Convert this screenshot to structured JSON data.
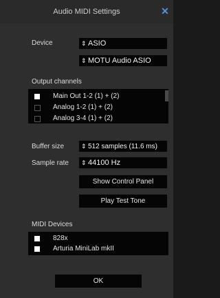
{
  "window": {
    "title": "Audio MIDI Settings"
  },
  "device": {
    "label": "Device",
    "driver": "ASIO",
    "interface": "MOTU Audio ASIO"
  },
  "output": {
    "heading": "Output channels",
    "items": [
      {
        "label": "Main Out 1-2 (1) + (2)",
        "checked": true
      },
      {
        "label": "Analog 1-2 (1) + (2)",
        "checked": false
      },
      {
        "label": "Analog 3-4 (1) + (2)",
        "checked": false
      }
    ]
  },
  "audio": {
    "buffer_label": "Buffer size",
    "buffer_value": "512 samples (11.6 ms)",
    "rate_label": "Sample rate",
    "rate_value": "44100 Hz"
  },
  "buttons": {
    "control_panel": "Show Control Panel",
    "test_tone": "Play Test Tone",
    "ok": "OK"
  },
  "midi": {
    "heading": "MIDI Devices",
    "items": [
      {
        "label": "828x",
        "checked": true
      },
      {
        "label": "Arturia MiniLab mkII",
        "checked": true
      }
    ]
  },
  "icons": {
    "close": "close-icon",
    "dropdown": "updown-arrow-icon"
  }
}
